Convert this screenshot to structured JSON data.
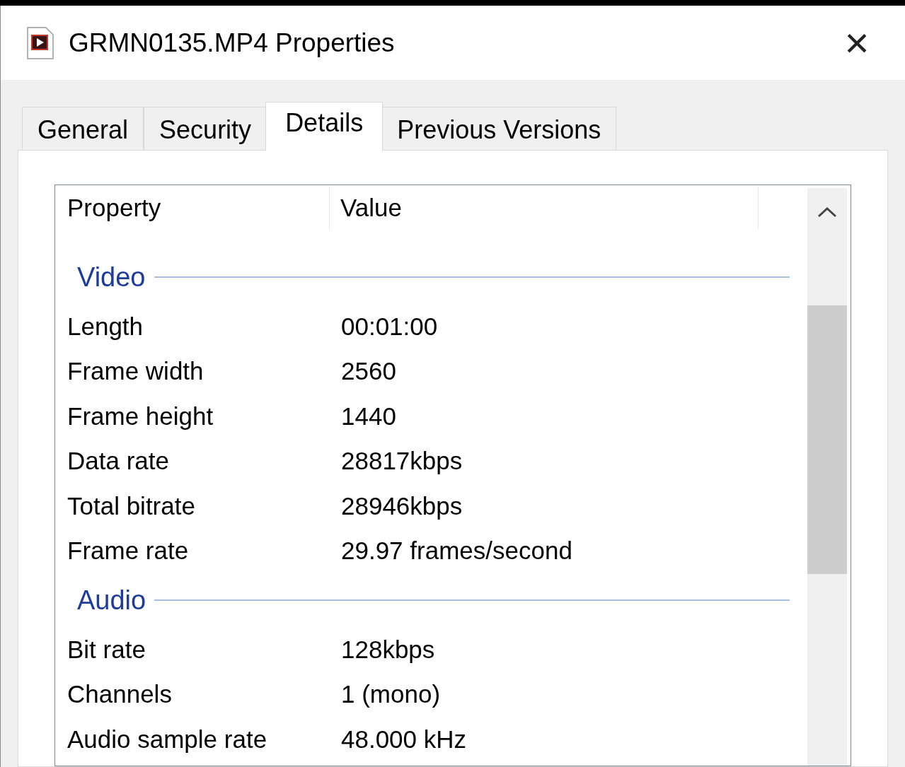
{
  "window": {
    "title": "GRMN0135.MP4 Properties",
    "close": "×"
  },
  "tabs": [
    {
      "label": "General",
      "selected": false
    },
    {
      "label": "Security",
      "selected": false
    },
    {
      "label": "Details",
      "selected": true
    },
    {
      "label": "Previous Versions",
      "selected": false
    }
  ],
  "table": {
    "columns": [
      "Property",
      "Value"
    ],
    "groups": [
      {
        "name": "Video",
        "rows": [
          {
            "property": "Length",
            "value": "00:01:00"
          },
          {
            "property": "Frame width",
            "value": "2560"
          },
          {
            "property": "Frame height",
            "value": "1440"
          },
          {
            "property": "Data rate",
            "value": "28817kbps"
          },
          {
            "property": "Total bitrate",
            "value": "28946kbps"
          },
          {
            "property": "Frame rate",
            "value": "29.97 frames/second"
          }
        ]
      },
      {
        "name": "Audio",
        "rows": [
          {
            "property": "Bit rate",
            "value": "128kbps"
          },
          {
            "property": "Channels",
            "value": "1 (mono)"
          },
          {
            "property": "Audio sample rate",
            "value": "48.000 kHz"
          }
        ]
      }
    ]
  }
}
